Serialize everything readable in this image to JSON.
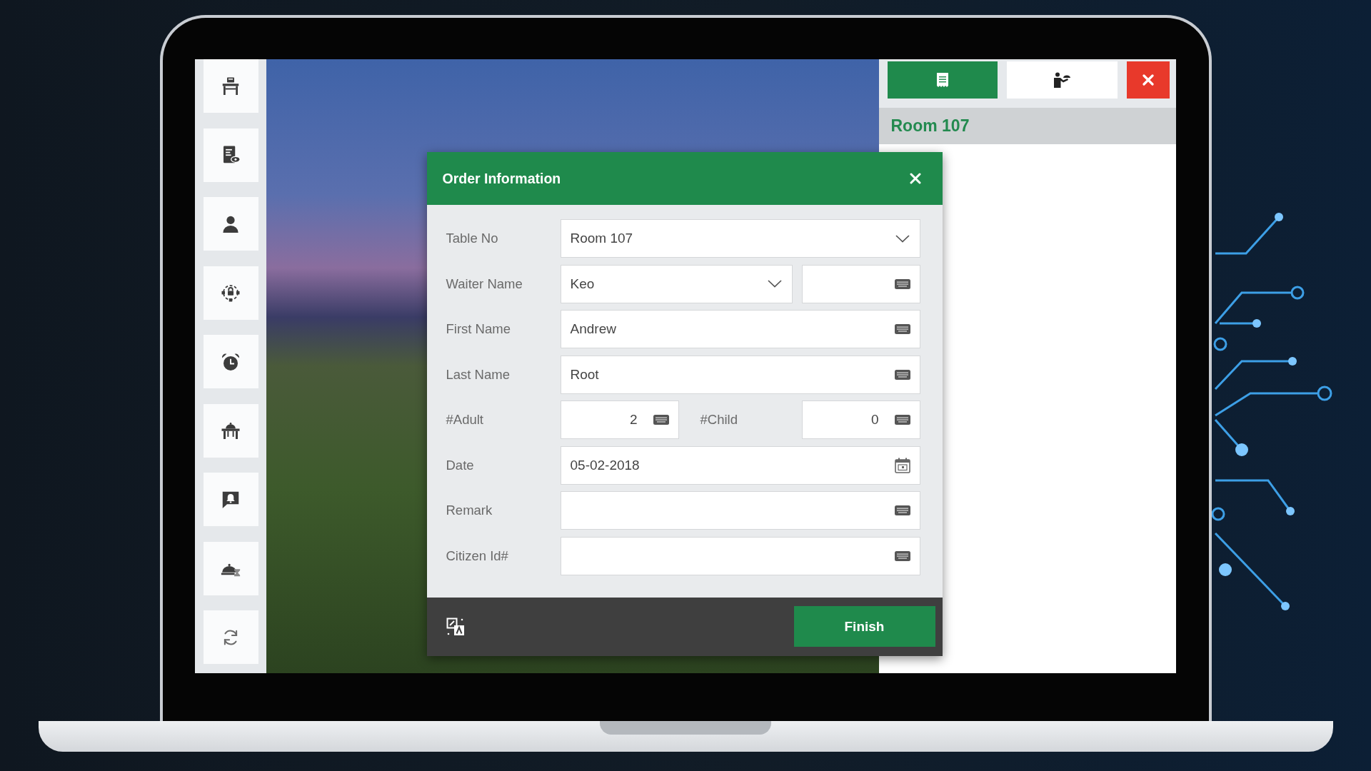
{
  "side_panel": {
    "header": "Room 107"
  },
  "dialog": {
    "title": "Order Information",
    "fields": [
      {
        "kind": "dropdown",
        "label": "Table No",
        "value": "Room 107"
      },
      {
        "kind": "dropdown_with_field",
        "label": "Waiter Name",
        "value": "Keo"
      },
      {
        "kind": "text",
        "label": "First Name",
        "value": "Andrew"
      },
      {
        "kind": "text",
        "label": "Last Name",
        "value": "Root"
      },
      {
        "kind": "pair",
        "label": "#Adult",
        "value": "2",
        "second": {
          "label": "#Child",
          "value": "0"
        }
      },
      {
        "kind": "date",
        "label": "Date",
        "value": "05-02-2018"
      },
      {
        "kind": "text",
        "label": "Remark"
      },
      {
        "kind": "text",
        "label": "Citizen Id#"
      }
    ],
    "finish_button": "Finish"
  }
}
